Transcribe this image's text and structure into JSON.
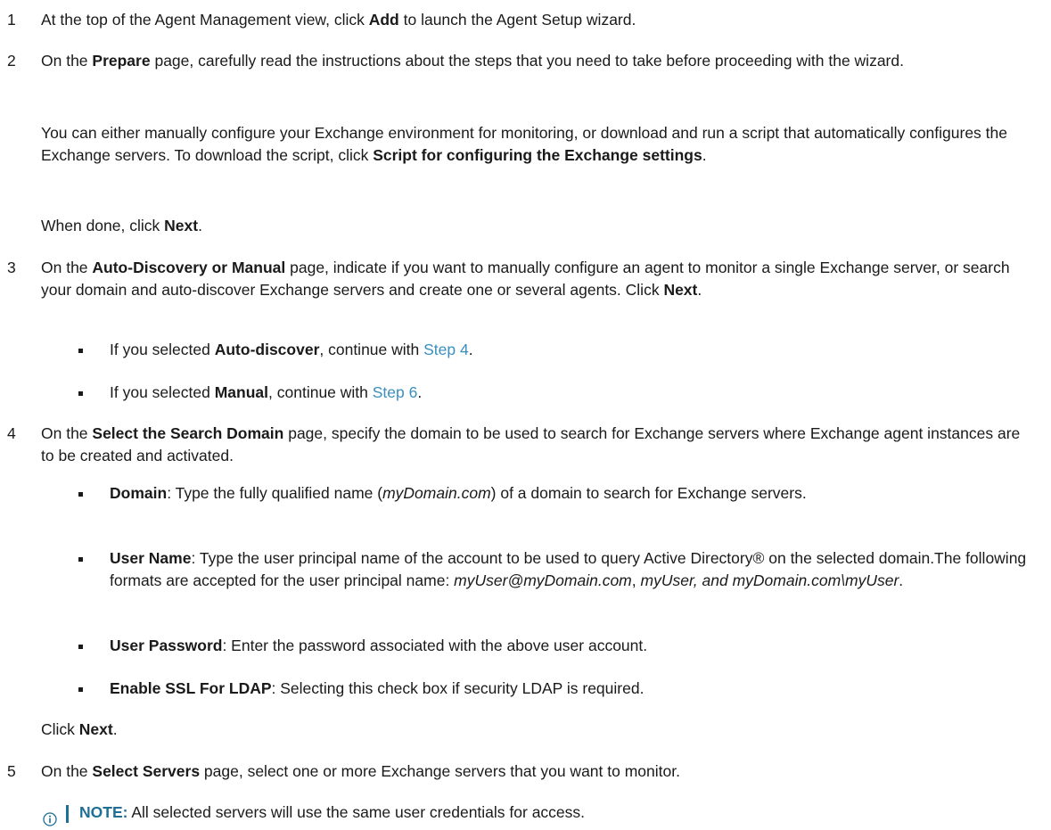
{
  "steps": {
    "s1": {
      "num": "1",
      "t1": "At the top of the Agent Management view, click ",
      "b1": "Add",
      "t2": " to launch the Agent Setup wizard."
    },
    "s2": {
      "num": "2",
      "t1": "On the ",
      "b1": "Prepare",
      "t2": " page, carefully read the instructions about the steps that you need to take before proceeding with the wizard.",
      "p1_t1": "You can either manually configure your Exchange environment for monitoring, or download and run a script that automatically configures the Exchange servers. To download the script, click ",
      "p1_b1": "Script for configuring the Exchange settings",
      "p1_t2": ".",
      "p2_t1": "When done, click ",
      "p2_b1": "Next",
      "p2_t2": "."
    },
    "s3": {
      "num": "3",
      "t1": "On the ",
      "b1": "Auto-Discovery or Manual",
      "t2": " page, indicate if you want to manually configure an agent to monitor a single Exchange server, or search your domain and auto-discover Exchange servers and create one or several agents. Click ",
      "b2": "Next",
      "t3": ".",
      "bullets": [
        {
          "t1": "If you selected ",
          "b1": "Auto-discover",
          "t2": ", continue with ",
          "link": "Step 4",
          "t3": "."
        },
        {
          "t1": "If you selected ",
          "b1": "Manual",
          "t2": ", continue with ",
          "link": "Step 6",
          "t3": "."
        }
      ]
    },
    "s4": {
      "num": "4",
      "t1": "On the ",
      "b1": "Select the Search Domain",
      "t2": " page, specify the domain to be used to search for Exchange servers where Exchange agent instances are to be created and activated.",
      "bullets": [
        {
          "b1": "Domain",
          "t1": ": Type the fully qualified name (",
          "i1": "myDomain.com",
          "t2": ") of a domain to search for Exchange servers."
        },
        {
          "b1": "User Name",
          "t1": ": Type the user principal name of the account to be used to query Active Directory® on the selected domain.The following formats are accepted for the user principal name: ",
          "i1": "myUser@myDomain.com",
          "t2": ", ",
          "i2": "myUser, and myDomain.com\\myUser",
          "t3": "."
        },
        {
          "b1": "User Password",
          "t1": ": Enter the password associated with the above user account."
        },
        {
          "b1": "Enable SSL For LDAP",
          "t1": ": Selecting this check box if security LDAP is required."
        }
      ],
      "after_t1": "Click ",
      "after_b1": "Next",
      "after_t2": "."
    },
    "s5": {
      "num": "5",
      "t1": "On the ",
      "b1": "Select Servers",
      "t2": " page, select one or more Exchange servers that you want to monitor."
    }
  },
  "note": {
    "icon": "info-icon",
    "label": "NOTE:",
    "text": " All selected servers will use the same user credentials for access."
  },
  "colors": {
    "link": "#3a8fbf",
    "note_accent": "#1f6e96",
    "text": "#1a1a1a"
  }
}
